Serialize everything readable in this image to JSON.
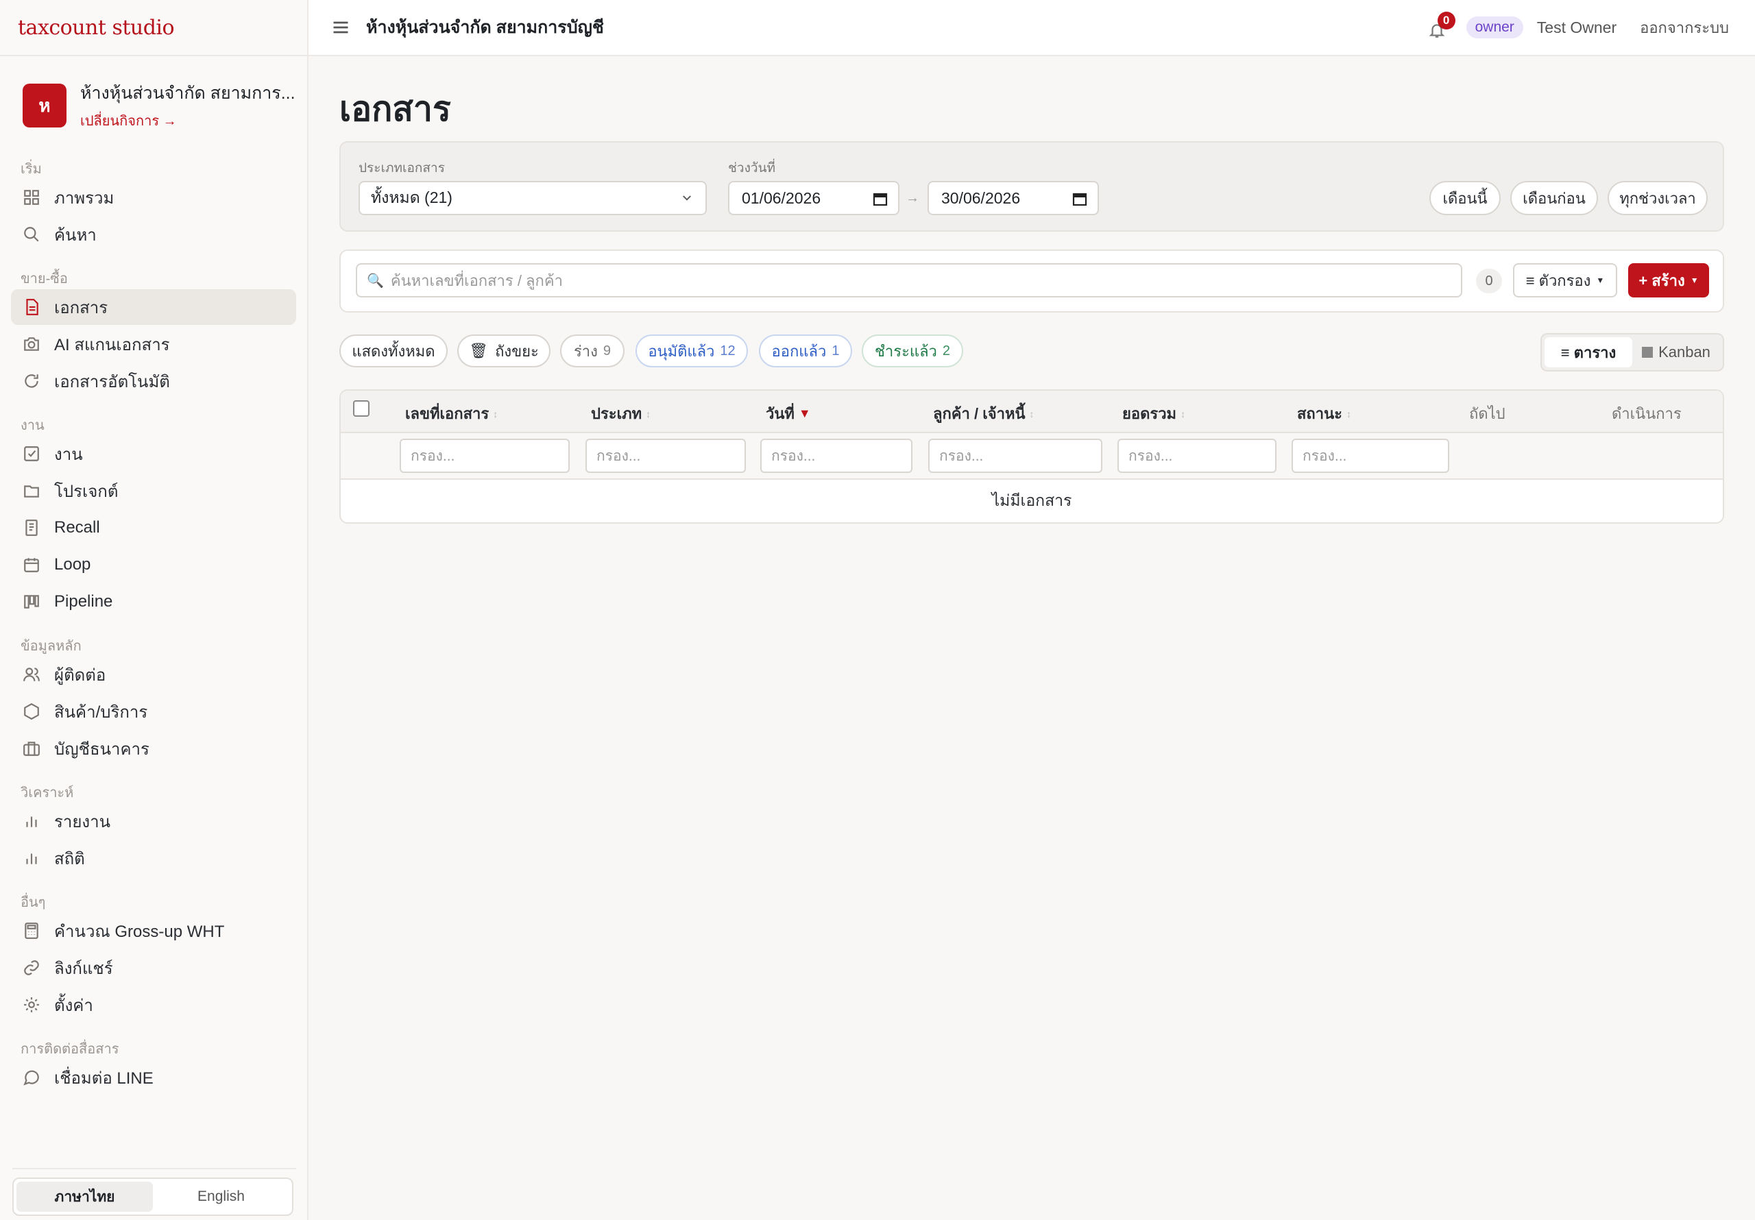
{
  "app": {
    "brand": "taxcount studio"
  },
  "business": {
    "initial": "ห",
    "name": "ห้างหุ้นส่วนจำกัด สยามการ...",
    "switch_label": "เปลี่ยนกิจการ →"
  },
  "sidebar": {
    "sections": [
      {
        "label": "เริ่ม",
        "items": [
          {
            "label": "ภาพรวม",
            "icon": "grid-icon"
          },
          {
            "label": "ค้นหา",
            "icon": "search-icon"
          }
        ]
      },
      {
        "label": "ขาย-ซื้อ",
        "items": [
          {
            "label": "เอกสาร",
            "icon": "document-icon",
            "active": true
          },
          {
            "label": "AI สแกนเอกสาร",
            "icon": "camera-icon"
          },
          {
            "label": "เอกสารอัตโนมัติ",
            "icon": "refresh-icon"
          }
        ]
      },
      {
        "label": "งาน",
        "items": [
          {
            "label": "งาน",
            "icon": "checkbox-icon"
          },
          {
            "label": "โปรเจกต์",
            "icon": "folder-icon"
          },
          {
            "label": "Recall",
            "icon": "receipt-icon"
          },
          {
            "label": "Loop",
            "icon": "calendar-icon"
          },
          {
            "label": "Pipeline",
            "icon": "kanban-icon"
          }
        ]
      },
      {
        "label": "ข้อมูลหลัก",
        "items": [
          {
            "label": "ผู้ติดต่อ",
            "icon": "users-icon"
          },
          {
            "label": "สินค้า/บริการ",
            "icon": "box-icon"
          },
          {
            "label": "บัญชีธนาคาร",
            "icon": "briefcase-icon"
          }
        ]
      },
      {
        "label": "วิเคราะห์",
        "items": [
          {
            "label": "รายงาน",
            "icon": "bar-chart-icon"
          },
          {
            "label": "สถิติ",
            "icon": "bar-chart-icon"
          }
        ]
      },
      {
        "label": "อื่นๆ",
        "items": [
          {
            "label": "คำนวณ Gross-up WHT",
            "icon": "calculator-icon"
          },
          {
            "label": "ลิงก์แชร์",
            "icon": "link-icon"
          },
          {
            "label": "ตั้งค่า",
            "icon": "gear-icon"
          }
        ]
      },
      {
        "label": "การติดต่อสื่อสาร",
        "items": [
          {
            "label": "เชื่อมต่อ LINE",
            "icon": "chat-icon"
          }
        ]
      }
    ],
    "language": {
      "thai": "ภาษาไทย",
      "english": "English",
      "selected": "ภาษาไทย"
    }
  },
  "topbar": {
    "title": "ห้างหุ้นส่วนจำกัด สยามการบัญชี",
    "notification_count": "0",
    "role": "owner",
    "user": "Test Owner",
    "logout": "ออกจากระบบ"
  },
  "main": {
    "title": "เอกสาร",
    "filters": {
      "doc_type_label": "ประเภทเอกสาร",
      "doc_type_value": "ทั้งหมด (21)",
      "date_range_label": "ช่วงวันที่",
      "date_from": "01/06/2026",
      "date_arrow": "→",
      "date_to": "30/06/2026",
      "quick": {
        "this_month": "เดือนนี้",
        "last_month": "เดือนก่อน",
        "all_time": "ทุกช่วงเวลา"
      }
    },
    "search": {
      "placeholder": "ค้นหาเลขที่เอกสาร / ลูกค้า",
      "count": "0",
      "filter_label": "≡ ตัวกรอง",
      "create_label": "+ สร้าง"
    },
    "status_chips": [
      {
        "label": "แสดงทั้งหมด",
        "count": ""
      },
      {
        "label": "ถังขยะ",
        "count": ""
      },
      {
        "label": "ร่าง",
        "count": "9"
      },
      {
        "label": "อนุมัติแล้ว",
        "count": "12"
      },
      {
        "label": "ออกแล้ว",
        "count": "1"
      },
      {
        "label": "ชำระแล้ว",
        "count": "2"
      }
    ],
    "view": {
      "table": "≡ ตาราง",
      "kanban": "Kanban",
      "selected": "table"
    },
    "table": {
      "columns": [
        "เลขที่เอกสาร",
        "ประเภท",
        "วันที่",
        "ลูกค้า / เจ้าหนี้",
        "ยอดรวม",
        "สถานะ",
        "ถัดไป",
        "ดำเนินการ"
      ],
      "sorted_by": "วันที่",
      "filter_placeholder": "กรอง...",
      "empty_message": "ไม่มีเอกสาร"
    }
  },
  "colors": {
    "accent": "#c0141c",
    "role_badge": "#6b43c8",
    "approved": "#2f5fc6",
    "paid": "#1f7a47"
  }
}
